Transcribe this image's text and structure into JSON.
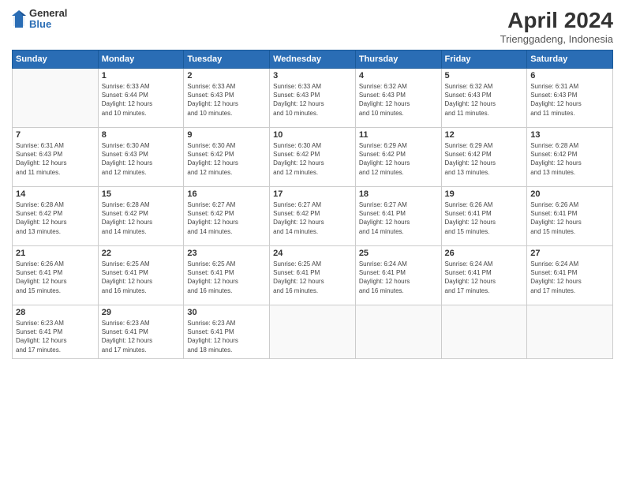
{
  "header": {
    "logo_general": "General",
    "logo_blue": "Blue",
    "month_year": "April 2024",
    "location": "Trienggadeng, Indonesia"
  },
  "days_of_week": [
    "Sunday",
    "Monday",
    "Tuesday",
    "Wednesday",
    "Thursday",
    "Friday",
    "Saturday"
  ],
  "weeks": [
    [
      {
        "day": "",
        "info": ""
      },
      {
        "day": "1",
        "info": "Sunrise: 6:33 AM\nSunset: 6:44 PM\nDaylight: 12 hours\nand 10 minutes."
      },
      {
        "day": "2",
        "info": "Sunrise: 6:33 AM\nSunset: 6:43 PM\nDaylight: 12 hours\nand 10 minutes."
      },
      {
        "day": "3",
        "info": "Sunrise: 6:33 AM\nSunset: 6:43 PM\nDaylight: 12 hours\nand 10 minutes."
      },
      {
        "day": "4",
        "info": "Sunrise: 6:32 AM\nSunset: 6:43 PM\nDaylight: 12 hours\nand 10 minutes."
      },
      {
        "day": "5",
        "info": "Sunrise: 6:32 AM\nSunset: 6:43 PM\nDaylight: 12 hours\nand 11 minutes."
      },
      {
        "day": "6",
        "info": "Sunrise: 6:31 AM\nSunset: 6:43 PM\nDaylight: 12 hours\nand 11 minutes."
      }
    ],
    [
      {
        "day": "7",
        "info": "Sunrise: 6:31 AM\nSunset: 6:43 PM\nDaylight: 12 hours\nand 11 minutes."
      },
      {
        "day": "8",
        "info": "Sunrise: 6:30 AM\nSunset: 6:43 PM\nDaylight: 12 hours\nand 12 minutes."
      },
      {
        "day": "9",
        "info": "Sunrise: 6:30 AM\nSunset: 6:42 PM\nDaylight: 12 hours\nand 12 minutes."
      },
      {
        "day": "10",
        "info": "Sunrise: 6:30 AM\nSunset: 6:42 PM\nDaylight: 12 hours\nand 12 minutes."
      },
      {
        "day": "11",
        "info": "Sunrise: 6:29 AM\nSunset: 6:42 PM\nDaylight: 12 hours\nand 12 minutes."
      },
      {
        "day": "12",
        "info": "Sunrise: 6:29 AM\nSunset: 6:42 PM\nDaylight: 12 hours\nand 13 minutes."
      },
      {
        "day": "13",
        "info": "Sunrise: 6:28 AM\nSunset: 6:42 PM\nDaylight: 12 hours\nand 13 minutes."
      }
    ],
    [
      {
        "day": "14",
        "info": "Sunrise: 6:28 AM\nSunset: 6:42 PM\nDaylight: 12 hours\nand 13 minutes."
      },
      {
        "day": "15",
        "info": "Sunrise: 6:28 AM\nSunset: 6:42 PM\nDaylight: 12 hours\nand 14 minutes."
      },
      {
        "day": "16",
        "info": "Sunrise: 6:27 AM\nSunset: 6:42 PM\nDaylight: 12 hours\nand 14 minutes."
      },
      {
        "day": "17",
        "info": "Sunrise: 6:27 AM\nSunset: 6:42 PM\nDaylight: 12 hours\nand 14 minutes."
      },
      {
        "day": "18",
        "info": "Sunrise: 6:27 AM\nSunset: 6:41 PM\nDaylight: 12 hours\nand 14 minutes."
      },
      {
        "day": "19",
        "info": "Sunrise: 6:26 AM\nSunset: 6:41 PM\nDaylight: 12 hours\nand 15 minutes."
      },
      {
        "day": "20",
        "info": "Sunrise: 6:26 AM\nSunset: 6:41 PM\nDaylight: 12 hours\nand 15 minutes."
      }
    ],
    [
      {
        "day": "21",
        "info": "Sunrise: 6:26 AM\nSunset: 6:41 PM\nDaylight: 12 hours\nand 15 minutes."
      },
      {
        "day": "22",
        "info": "Sunrise: 6:25 AM\nSunset: 6:41 PM\nDaylight: 12 hours\nand 16 minutes."
      },
      {
        "day": "23",
        "info": "Sunrise: 6:25 AM\nSunset: 6:41 PM\nDaylight: 12 hours\nand 16 minutes."
      },
      {
        "day": "24",
        "info": "Sunrise: 6:25 AM\nSunset: 6:41 PM\nDaylight: 12 hours\nand 16 minutes."
      },
      {
        "day": "25",
        "info": "Sunrise: 6:24 AM\nSunset: 6:41 PM\nDaylight: 12 hours\nand 16 minutes."
      },
      {
        "day": "26",
        "info": "Sunrise: 6:24 AM\nSunset: 6:41 PM\nDaylight: 12 hours\nand 17 minutes."
      },
      {
        "day": "27",
        "info": "Sunrise: 6:24 AM\nSunset: 6:41 PM\nDaylight: 12 hours\nand 17 minutes."
      }
    ],
    [
      {
        "day": "28",
        "info": "Sunrise: 6:23 AM\nSunset: 6:41 PM\nDaylight: 12 hours\nand 17 minutes."
      },
      {
        "day": "29",
        "info": "Sunrise: 6:23 AM\nSunset: 6:41 PM\nDaylight: 12 hours\nand 17 minutes."
      },
      {
        "day": "30",
        "info": "Sunrise: 6:23 AM\nSunset: 6:41 PM\nDaylight: 12 hours\nand 18 minutes."
      },
      {
        "day": "",
        "info": ""
      },
      {
        "day": "",
        "info": ""
      },
      {
        "day": "",
        "info": ""
      },
      {
        "day": "",
        "info": ""
      }
    ]
  ]
}
